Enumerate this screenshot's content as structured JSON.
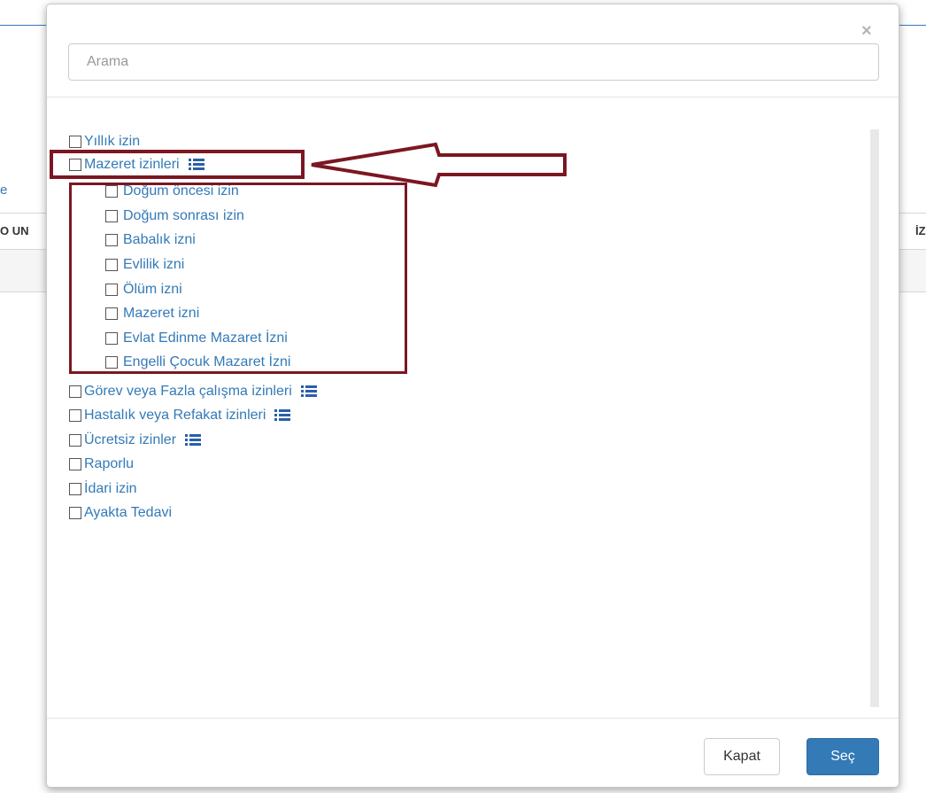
{
  "background": {
    "link_fragment": "e",
    "header_left_fragment": "O UN",
    "header_right_fragment": "İZ"
  },
  "modal": {
    "close_symbol": "×",
    "search": {
      "placeholder": "Arama",
      "value": ""
    },
    "tree": {
      "items": [
        {
          "label": "Yıllık izin",
          "checked": false,
          "has_children": false
        },
        {
          "label": "Mazeret izinleri",
          "checked": false,
          "has_children": true,
          "expanded": true,
          "children": [
            {
              "label": "Doğum öncesi izin",
              "checked": false
            },
            {
              "label": "Doğum sonrası izin",
              "checked": false
            },
            {
              "label": "Babalık izni",
              "checked": false
            },
            {
              "label": "Evlilik izni",
              "checked": false
            },
            {
              "label": "Ölüm izni",
              "checked": false
            },
            {
              "label": "Mazeret izni",
              "checked": false
            },
            {
              "label": "Evlat Edinme Mazaret İzni",
              "checked": false
            },
            {
              "label": "Engelli Çocuk Mazaret İzni",
              "checked": false
            }
          ]
        },
        {
          "label": "Görev veya Fazla çalışma izinleri",
          "checked": false,
          "has_children": true
        },
        {
          "label": "Hastalık veya Refakat izinleri",
          "checked": false,
          "has_children": true
        },
        {
          "label": "Ücretsiz izinler",
          "checked": false,
          "has_children": true
        },
        {
          "label": "Raporlu",
          "checked": false,
          "has_children": false
        },
        {
          "label": "İdari izin",
          "checked": false,
          "has_children": false
        },
        {
          "label": "Ayakta Tedavi",
          "checked": false,
          "has_children": false
        }
      ]
    },
    "footer": {
      "close_label": "Kapat",
      "select_label": "Seç"
    }
  },
  "colors": {
    "link": "#337ab7",
    "primary_button": "#337ab7",
    "annotation": "#7b1722"
  },
  "icons": {
    "tree_expand": "list-icon",
    "close": "close-icon"
  }
}
